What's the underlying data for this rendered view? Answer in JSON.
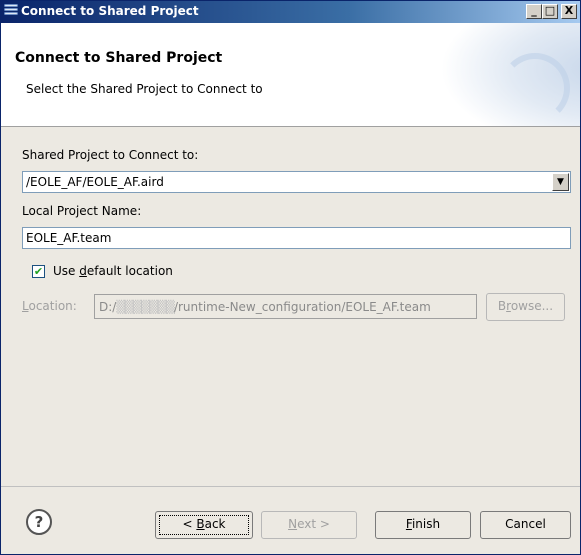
{
  "window": {
    "title": "Connect to Shared Project",
    "minimize": "_",
    "maximize": "□",
    "close": "X"
  },
  "banner": {
    "heading": "Connect to Shared Project",
    "description": "Select the Shared Project to Connect to"
  },
  "form": {
    "shared_project_label": "Shared Project to Connect to:",
    "shared_project_value": "/EOLE_AF/EOLE_AF.aird",
    "local_name_label": "Local Project Name:",
    "local_name_value": "EOLE_AF.team",
    "use_default_location_label_pre": "Use ",
    "use_default_location_label_mnemonic": "d",
    "use_default_location_label_post": "efault location",
    "use_default_location_checked": true,
    "location_label_mnemonic": "L",
    "location_label_rest": "ocation:",
    "location_value_prefix": "D:/",
    "location_value_masked": "▒▒▒▒▒▒▒",
    "location_value_suffix": "/runtime-New_configuration/EOLE_AF.team",
    "browse_pre": "B",
    "browse_mnemonic": "r",
    "browse_post": "owse..."
  },
  "footer": {
    "help_icon": "?",
    "back_mnemonic": "B",
    "back_prefix": "< ",
    "back_rest": "ack",
    "next_mnemonic": "N",
    "next_rest": "ext >",
    "finish_mnemonic": "F",
    "finish_rest": "inish",
    "cancel_label": "Cancel"
  }
}
